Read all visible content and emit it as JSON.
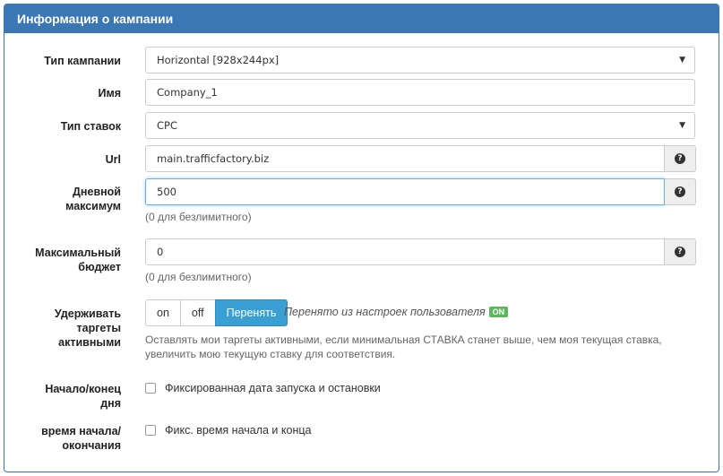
{
  "panel": {
    "title": "Информация о кампании"
  },
  "fields": {
    "campaign_type": {
      "label": "Тип кампании",
      "value": "Horizontal [928x244px]"
    },
    "name": {
      "label": "Имя",
      "value": "Company_1"
    },
    "bid_type": {
      "label": "Тип ставок",
      "value": "CPC"
    },
    "url": {
      "label": "Url",
      "value": "main.trafficfactory.biz"
    },
    "daily_max": {
      "label_line1": "Дневной",
      "label_line2": "максимум",
      "value": "500",
      "help": "(0 для безлимитного)"
    },
    "max_budget": {
      "label_line1": "Максимальный",
      "label_line2": "бюджет",
      "value": "0",
      "help": "(0 для безлимитного)"
    },
    "keep_targets": {
      "label_line1": "Удерживать",
      "label_line2": "таргеты",
      "label_line3": "активными",
      "options": [
        "on",
        "off",
        "Перенять"
      ],
      "selected": "Перенять",
      "inherit_note": "Перенято из настроек пользователя",
      "inherit_badge": "ON",
      "help_line1": "Оставлять мои таргеты активными, если минимальная СТАВКА станет выше, чем моя текущая ставка,",
      "help_line2": "увеличить мою текущую ставку для соответствия."
    },
    "start_end_date": {
      "label_line1": "Начало/конец",
      "label_line2": "дня",
      "checkbox_label": "Фиксированная дата запуска и остановки",
      "checked": false
    },
    "start_end_time": {
      "label_line1": "время начала/",
      "label_line2": "окончания",
      "checkbox_label": "Фикс. время начала и конца",
      "checked": false
    }
  },
  "icons": {
    "select_caret": "caret-down-icon",
    "help": "question-circle-icon"
  },
  "colors": {
    "header": "#3b76b5",
    "active_button": "#3aa0d4",
    "badge": "#5cb85c",
    "focus": "#66afe9"
  }
}
